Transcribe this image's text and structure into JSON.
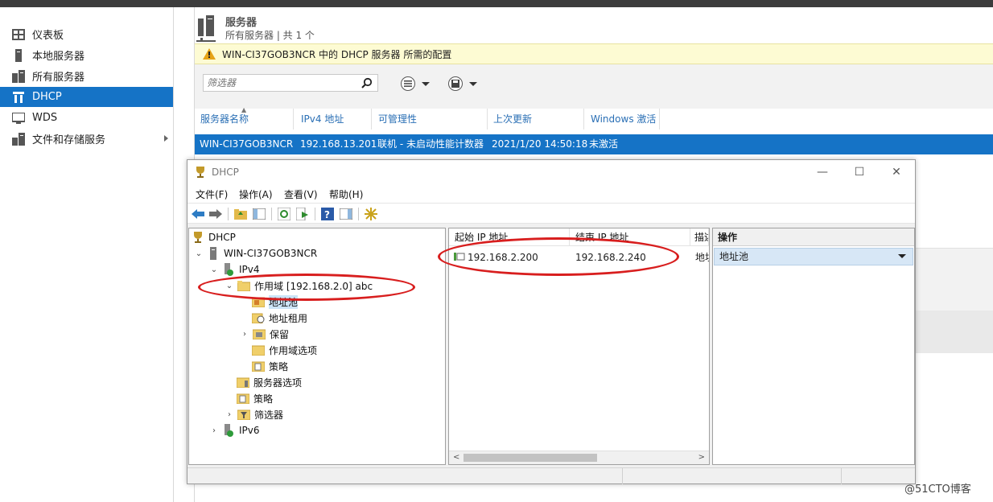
{
  "sidebar": {
    "items": [
      {
        "label": "仪表板",
        "icon": "dashboard-icon"
      },
      {
        "label": "本地服务器",
        "icon": "server-icon"
      },
      {
        "label": "所有服务器",
        "icon": "servers-icon"
      },
      {
        "label": "DHCP",
        "icon": "dhcp-icon",
        "selected": true
      },
      {
        "label": "WDS",
        "icon": "wds-icon"
      },
      {
        "label": "文件和存储服务",
        "icon": "file-storage-icon"
      }
    ]
  },
  "header": {
    "title": "服务器",
    "subtitle": "所有服务器 | 共 1 个"
  },
  "notification": {
    "text": "WIN-CI37GOB3NCR 中的 DHCP 服务器 所需的配置"
  },
  "filter": {
    "placeholder": "筛选器"
  },
  "server_table": {
    "columns": [
      "服务器名称",
      "IPv4 地址",
      "可管理性",
      "上次更新",
      "Windows 激活"
    ],
    "rows": [
      {
        "name": "WIN-CI37GOB3NCR",
        "ipv4": "192.168.13.201",
        "manageability": "联机 - 未启动性能计数器",
        "last_update": "2021/1/20 14:50:18",
        "activation": "未激活"
      }
    ]
  },
  "dhcp_window": {
    "title": "DHCP",
    "window_buttons": {
      "minimize": "—",
      "maximize": "☐",
      "close": "✕"
    },
    "menu": [
      "文件(F)",
      "操作(A)",
      "查看(V)",
      "帮助(H)"
    ],
    "tree": {
      "root": "DHCP",
      "server": "WIN-CI37GOB3NCR",
      "ipv4": "IPv4",
      "scope": "作用域 [192.168.2.0] abc",
      "address_pool": "地址池",
      "address_leases": "地址租用",
      "reservations": "保留",
      "scope_options": "作用域选项",
      "scope_policies": "策略",
      "server_options": "服务器选项",
      "policies": "策略",
      "filters": "筛选器",
      "ipv6": "IPv6"
    },
    "list": {
      "columns": [
        "起始 IP 地址",
        "结束 IP 地址",
        "描述"
      ],
      "rows": [
        {
          "start": "192.168.2.200",
          "end": "192.168.2.240",
          "desc": "地址"
        }
      ]
    },
    "actions": {
      "header": "操作",
      "item": "地址池"
    }
  },
  "watermark": "@51CTO博客",
  "colors": {
    "accent": "#1573c6",
    "annotation": "#d81e1e",
    "notification_bg": "#fdfbd3"
  }
}
